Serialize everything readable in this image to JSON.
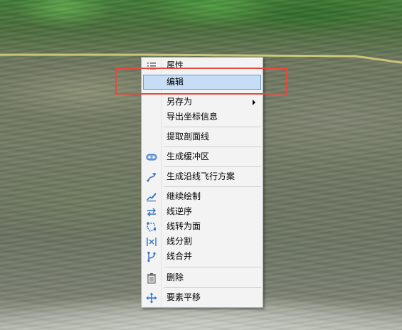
{
  "context_menu": {
    "items": [
      {
        "label": "属性",
        "icon": "list-icon"
      },
      {
        "label": "编辑",
        "icon": "",
        "highlighted": true
      },
      {
        "label": "另存为",
        "icon": "",
        "submenu": true
      },
      {
        "label": "导出坐标信息",
        "icon": ""
      },
      {
        "label": "提取剖面线",
        "icon": ""
      },
      {
        "label": "生成缓冲区",
        "icon": "buffer-icon"
      },
      {
        "label": "生成沿线飞行方案",
        "icon": "flight-route-icon"
      },
      {
        "label": "继续绘制",
        "icon": "continue-draw-icon"
      },
      {
        "label": "线逆序",
        "icon": "reverse-line-icon"
      },
      {
        "label": "线转为面",
        "icon": "line-to-polygon-icon"
      },
      {
        "label": "线分割",
        "icon": "split-line-icon"
      },
      {
        "label": "线合并",
        "icon": "merge-line-icon"
      },
      {
        "label": "删除",
        "icon": "trash-icon"
      },
      {
        "label": "要素平移",
        "icon": "move-icon"
      }
    ]
  },
  "colors": {
    "highlight_box": "#e24a3d",
    "selected_item_bg": "#c5def5",
    "selected_item_border": "#5a9ad8",
    "boundary_line": "#c9c07a",
    "icon_blue": "#2f6fc7"
  }
}
